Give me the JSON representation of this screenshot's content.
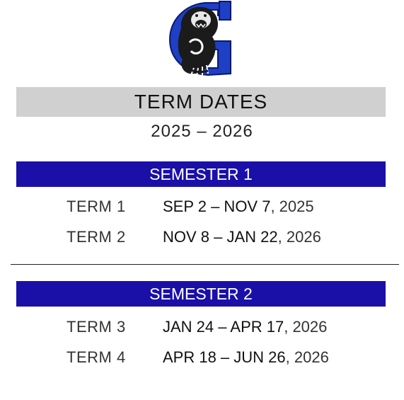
{
  "logo": {
    "icon": "bear-g-logo",
    "colors": {
      "blue": "#1f3fc4",
      "dark": "#1b1b1b"
    }
  },
  "title": "TERM DATES",
  "year_range": "2025 – 2026",
  "semesters": [
    {
      "label": "SEMESTER 1",
      "terms": [
        {
          "term": "TERM 1",
          "range": "SEP 2 – NOV 7",
          "year": ", 2025"
        },
        {
          "term": "TERM 2",
          "range": "NOV 8 – JAN 22",
          "year": ", 2026"
        }
      ]
    },
    {
      "label": "SEMESTER 2",
      "terms": [
        {
          "term": "TERM 3",
          "range": "JAN 24 – APR 17",
          "year": ", 2026"
        },
        {
          "term": "TERM 4",
          "range": "APR 18 – JUN 26",
          "year": ", 2026"
        }
      ]
    }
  ],
  "colors": {
    "semester_bar": "#1a10a8",
    "title_bar": "#d0d0d0"
  }
}
